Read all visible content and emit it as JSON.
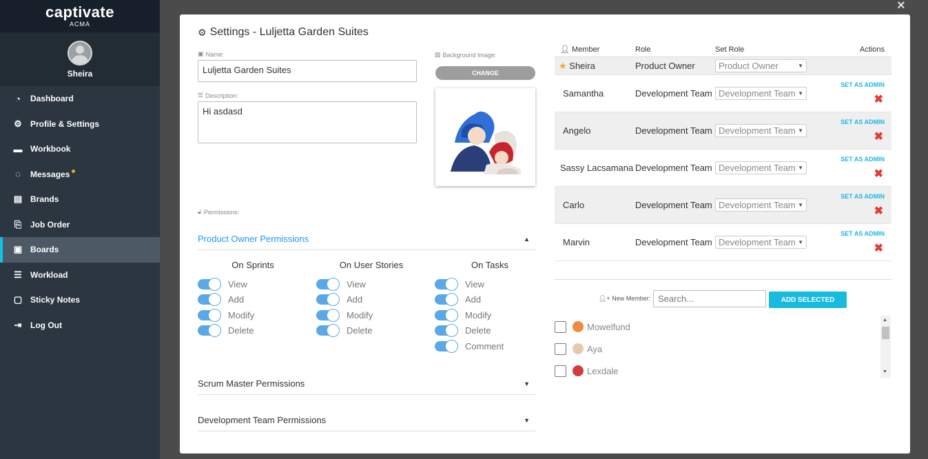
{
  "brand": {
    "name": "captivate",
    "sub": "ACMA"
  },
  "profile": {
    "name": "Sheira"
  },
  "nav": [
    {
      "label": "Dashboard",
      "icon": "dashboard-icon",
      "glyph": "◔"
    },
    {
      "label": "Profile & Settings",
      "icon": "gears-icon",
      "glyph": "⚙"
    },
    {
      "label": "Workbook",
      "icon": "book-icon",
      "glyph": "▬"
    },
    {
      "label": "Messages",
      "icon": "chat-icon",
      "glyph": "◌"
    },
    {
      "label": "Brands",
      "icon": "briefcase-icon",
      "glyph": "▤"
    },
    {
      "label": "Job Order",
      "icon": "clipboard-icon",
      "glyph": "⎘"
    },
    {
      "label": "Boards",
      "icon": "board-icon",
      "glyph": "▣"
    },
    {
      "label": "Workload",
      "icon": "list-icon",
      "glyph": "☰"
    },
    {
      "label": "Sticky Notes",
      "icon": "note-icon",
      "glyph": "▢"
    },
    {
      "label": "Log Out",
      "icon": "logout-icon",
      "glyph": "⇥"
    }
  ],
  "modal": {
    "title": "Settings - Luljetta Garden Suites",
    "name_label": "Name:",
    "name_value": "Luljetta Garden Suites",
    "desc_label": "Description:",
    "desc_value": "Hi asdasd",
    "bg_label": "Background Image:",
    "change_label": "CHANGE",
    "permissions_label": "Permissions:",
    "sections": [
      "Product Owner Permissions",
      "Scrum Master Permissions",
      "Development Team Permissions"
    ],
    "perm_cols": [
      {
        "title": "On Sprints",
        "items": [
          "View",
          "Add",
          "Modify",
          "Delete"
        ]
      },
      {
        "title": "On User Stories",
        "items": [
          "View",
          "Add",
          "Modify",
          "Delete"
        ]
      },
      {
        "title": "On Tasks",
        "items": [
          "View",
          "Add",
          "Modify",
          "Delete",
          "Comment"
        ]
      }
    ]
  },
  "members": {
    "headers": {
      "member": "Member",
      "role": "Role",
      "set_role": "Set Role",
      "actions": "Actions"
    },
    "owner": {
      "name": "Sheira",
      "role": "Product Owner",
      "set_role": "Product Owner"
    },
    "rows": [
      {
        "name": "Samantha",
        "role": "Development Team",
        "set_role": "Development Team"
      },
      {
        "name": "Angelo",
        "role": "Development Team",
        "set_role": "Development Team"
      },
      {
        "name": "Sassy Lacsamana",
        "role": "Development Team",
        "set_role": "Development Team"
      },
      {
        "name": "Carlo",
        "role": "Development Team",
        "set_role": "Development Team"
      },
      {
        "name": "Marvin",
        "role": "Development Team",
        "set_role": "Development Team"
      }
    ],
    "set_admin_label": "SET AS ADMIN",
    "new_member_label": "New Member:",
    "search_placeholder": "Search...",
    "add_selected_label": "ADD SELECTED",
    "candidates": [
      "Mowelfund",
      "Aya",
      "Lexdale"
    ]
  },
  "colors": {
    "accent": "#17bbe0",
    "toggle": "#5aa9e6",
    "delete": "#e53935",
    "sidebar": "#2b3640"
  }
}
